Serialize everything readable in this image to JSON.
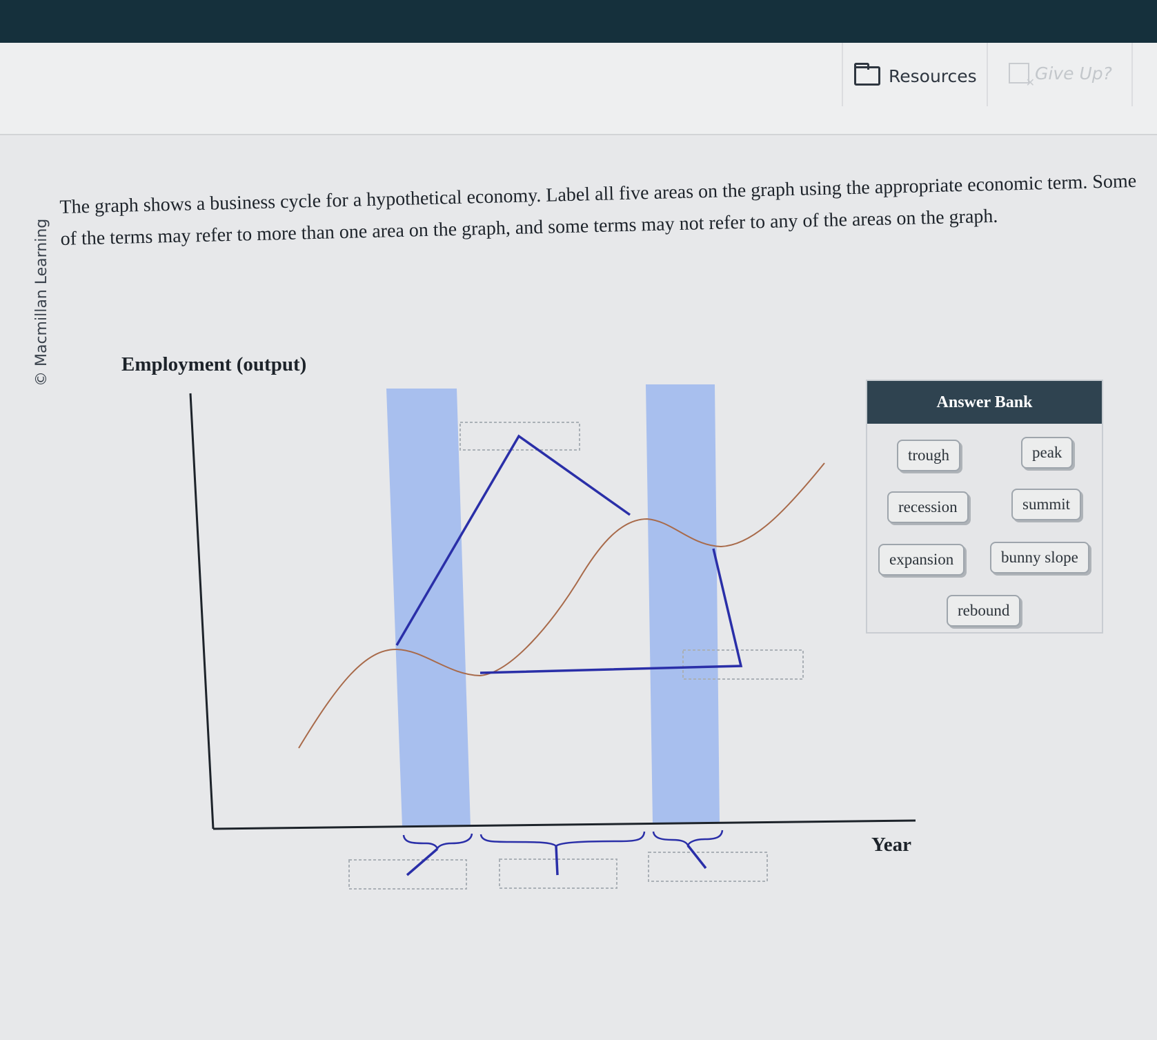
{
  "toolbar": {
    "resources_label": "Resources",
    "give_up_label": "Give Up?"
  },
  "credit": "© Macmillan Learning",
  "question": "The graph shows a business cycle for a hypothetical economy. Label all five areas on the graph using the appropriate economic term. Some of the terms may refer to more than one area on the graph, and some terms may not refer to any of the areas on the graph.",
  "graph": {
    "y_axis_label": "Employment (output)",
    "x_axis_label": "Year",
    "shaded_band_color": "#a8bfee",
    "curve_color": "#a86a4a",
    "pointer_color": "#2a2fa8"
  },
  "answer_bank": {
    "title": "Answer Bank",
    "items": [
      {
        "label": "trough"
      },
      {
        "label": "peak"
      },
      {
        "label": "recession"
      },
      {
        "label": "summit"
      },
      {
        "label": "expansion"
      },
      {
        "label": "bunny slope"
      },
      {
        "label": "rebound"
      }
    ]
  }
}
